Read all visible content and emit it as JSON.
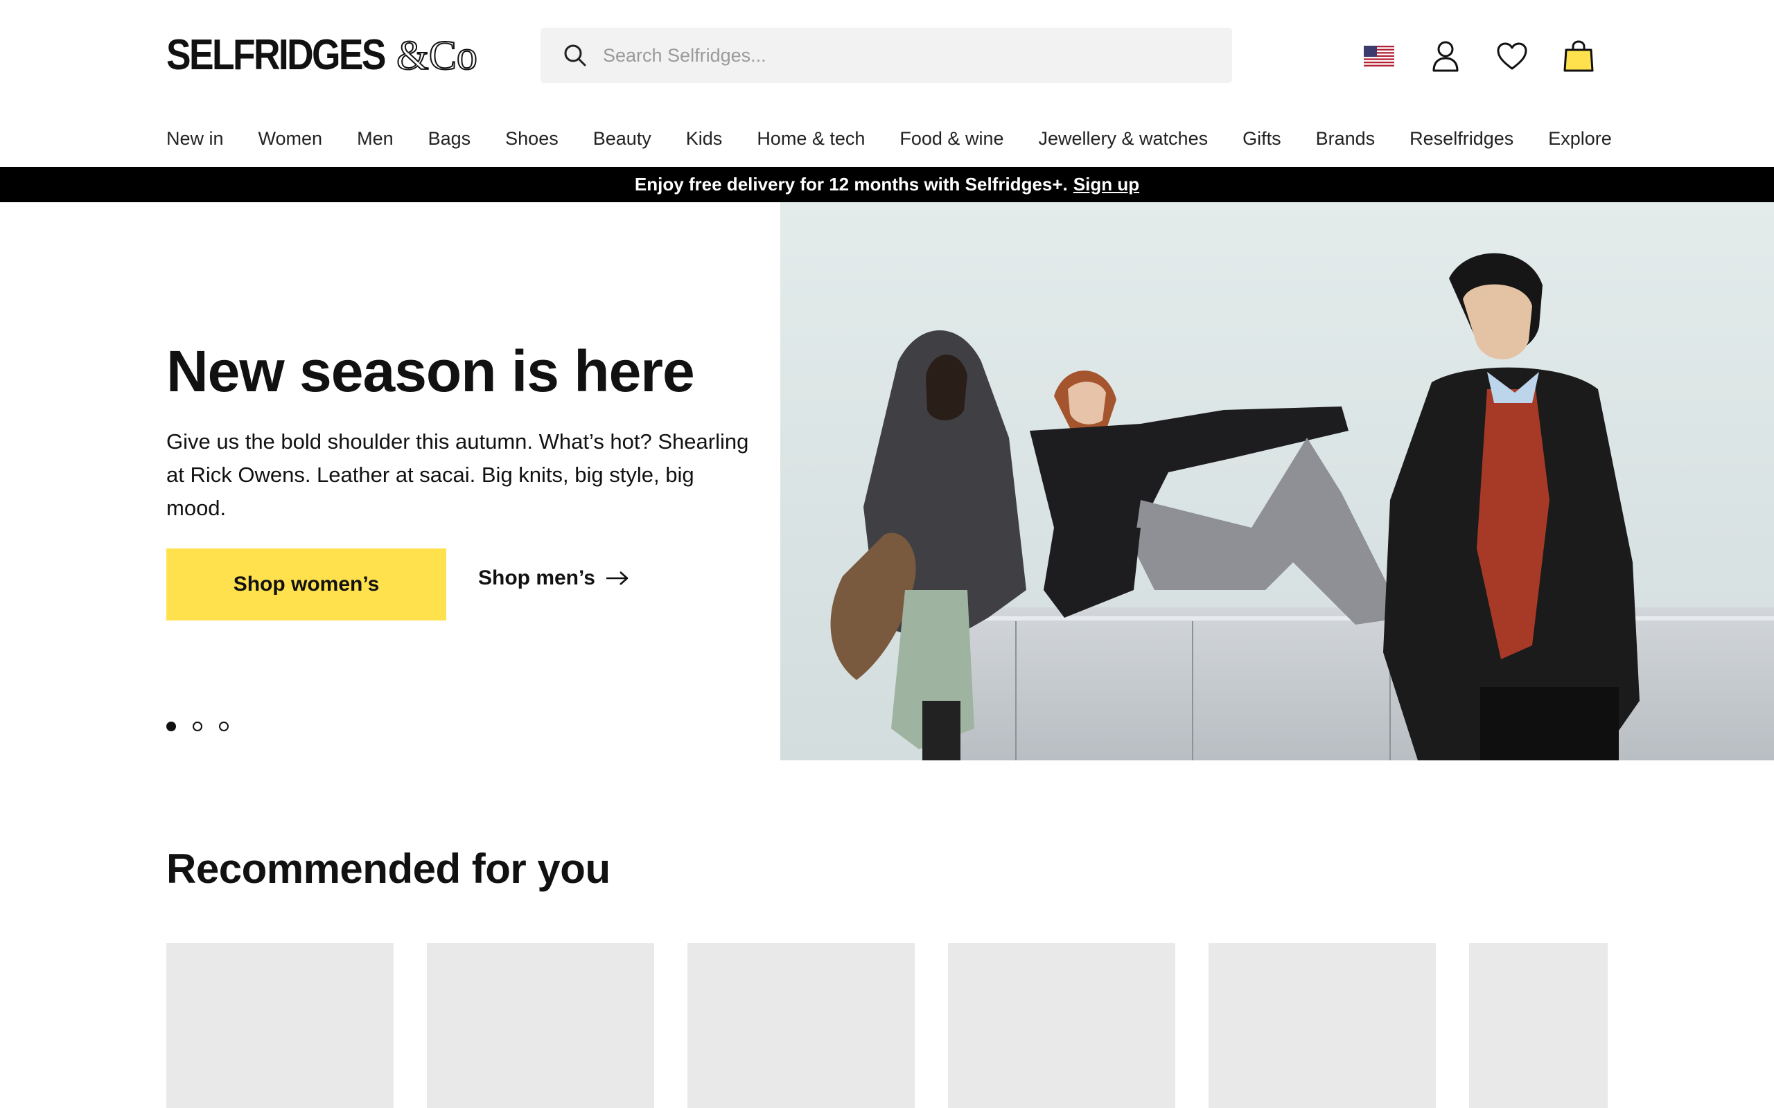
{
  "header": {
    "logo_text": "SELFRIDGES",
    "logo_suffix": "&Co",
    "search_placeholder": "Search Selfridges...",
    "icons": [
      "us-flag-icon",
      "account-icon",
      "wishlist-heart-icon",
      "shopping-bag-icon"
    ]
  },
  "nav": {
    "items": [
      {
        "label": "New in"
      },
      {
        "label": "Women"
      },
      {
        "label": "Men"
      },
      {
        "label": "Bags"
      },
      {
        "label": "Shoes"
      },
      {
        "label": "Beauty"
      },
      {
        "label": "Kids"
      },
      {
        "label": "Home & tech"
      },
      {
        "label": "Food & wine"
      },
      {
        "label": "Jewellery & watches"
      },
      {
        "label": "Gifts"
      },
      {
        "label": "Brands"
      },
      {
        "label": "Reselfridges"
      },
      {
        "label": "Explore"
      }
    ]
  },
  "promo": {
    "text": "Enjoy free delivery for 12 months with Selfridges+.",
    "link": "Sign up"
  },
  "hero": {
    "title": "New season is here",
    "description": "Give us the bold shoulder this autumn. What’s hot? Shearling at Rick Owens. Leather at sacai. Big knits, big style, big mood.",
    "primary_cta": "Shop women’s",
    "secondary_cta": "Shop men’s",
    "slide_count": 3,
    "active_slide": 1
  },
  "recommended": {
    "title": "Recommended for you",
    "card_count": 6
  },
  "colors": {
    "accent_yellow": "#ffe14d",
    "promo_bar": "#000000",
    "card_placeholder": "#e9e9e9",
    "hero_bg": "#dfe7e8"
  }
}
